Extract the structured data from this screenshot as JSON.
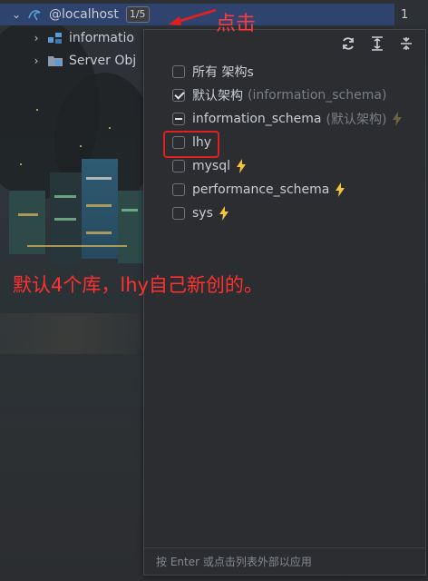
{
  "tree": {
    "host": {
      "label": "@localhost",
      "badge": "1/5"
    },
    "children": [
      {
        "label": "informatio"
      },
      {
        "label": "Server Obj"
      }
    ],
    "side_number": "1"
  },
  "popup": {
    "toolbar": [
      {
        "icon": "refresh-icon"
      },
      {
        "icon": "expand-all-icon"
      },
      {
        "icon": "collapse-all-icon"
      }
    ],
    "items": [
      {
        "label": "所有 架构s",
        "state": "unchecked",
        "note": "",
        "bolt": false
      },
      {
        "label": "默认架构",
        "state": "checked",
        "note": "(information_schema)",
        "bolt": false
      },
      {
        "label": "information_schema",
        "state": "partial",
        "note": "(默认架构)",
        "bolt": true
      },
      {
        "label": "lhy",
        "state": "unchecked",
        "note": "",
        "bolt": false
      },
      {
        "label": "mysql",
        "state": "unchecked",
        "note": "",
        "bolt": true
      },
      {
        "label": "performance_schema",
        "state": "unchecked",
        "note": "",
        "bolt": true
      },
      {
        "label": "sys",
        "state": "unchecked",
        "note": "",
        "bolt": true
      }
    ],
    "footer": "按 Enter 或点击列表外部以应用"
  },
  "annotations": {
    "click": "点击",
    "note": "默认4个库，lhy自己新创的。"
  },
  "colors": {
    "selection": "#2e436e",
    "annotation": "#ff3030",
    "bolt": "#f2c53d"
  }
}
